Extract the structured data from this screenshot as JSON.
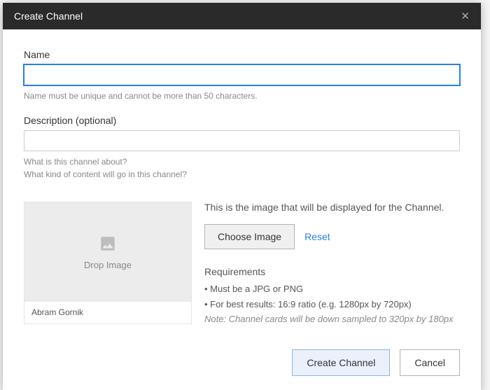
{
  "header": {
    "title": "Create Channel"
  },
  "name": {
    "label": "Name",
    "value": "",
    "helper": "Name must be unique and cannot be more than 50 characters."
  },
  "description": {
    "label": "Description (optional)",
    "value": "",
    "helper1": "What is this channel about?",
    "helper2": "What kind of content will go in this channel?"
  },
  "image": {
    "drop_text": "Drop Image",
    "card_name": "Abram Gornik",
    "info": "This is the image that will be displayed for the Channel.",
    "choose_btn": "Choose Image",
    "reset_link": "Reset",
    "req_title": "Requirements",
    "req1": "• Must be a JPG or PNG",
    "req2": "• For best results: 16:9 ratio (e.g. 1280px by 720px)",
    "req_note": "Note: Channel cards will be down sampled to 320px by 180px"
  },
  "footer": {
    "create": "Create Channel",
    "cancel": "Cancel"
  }
}
